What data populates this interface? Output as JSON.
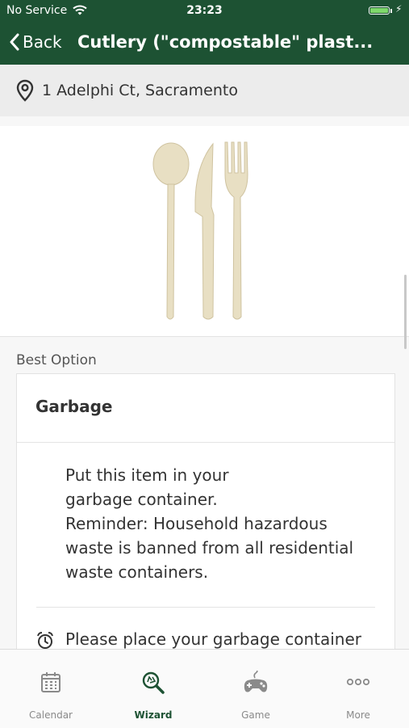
{
  "status": {
    "carrier": "No Service",
    "time": "23:23"
  },
  "nav": {
    "back_label": "Back",
    "title": "Cutlery (\"compostable\" plast..."
  },
  "address": {
    "text": "1 Adelphi Ct, Sacramento"
  },
  "best_option": {
    "label": "Best Option",
    "title": "Garbage",
    "lines": [
      "Put this item in your",
      "garbage container.",
      "Reminder: Household hazardous",
      "waste is banned from all residential",
      "waste containers."
    ],
    "schedule_text": "Please place your garbage container"
  },
  "tabs": [
    {
      "label": "Calendar",
      "icon": "calendar-icon",
      "active": false
    },
    {
      "label": "Wizard",
      "icon": "recycle-search-icon",
      "active": true
    },
    {
      "label": "Game",
      "icon": "gamepad-icon",
      "active": false
    },
    {
      "label": "More",
      "icon": "more-dots-icon",
      "active": false
    }
  ],
  "colors": {
    "header": "#1d5233",
    "active_tab": "#1d5233",
    "inactive_tab": "#8a8a8a",
    "utensil": "#e8dfc3",
    "battery": "#7ed86b"
  }
}
